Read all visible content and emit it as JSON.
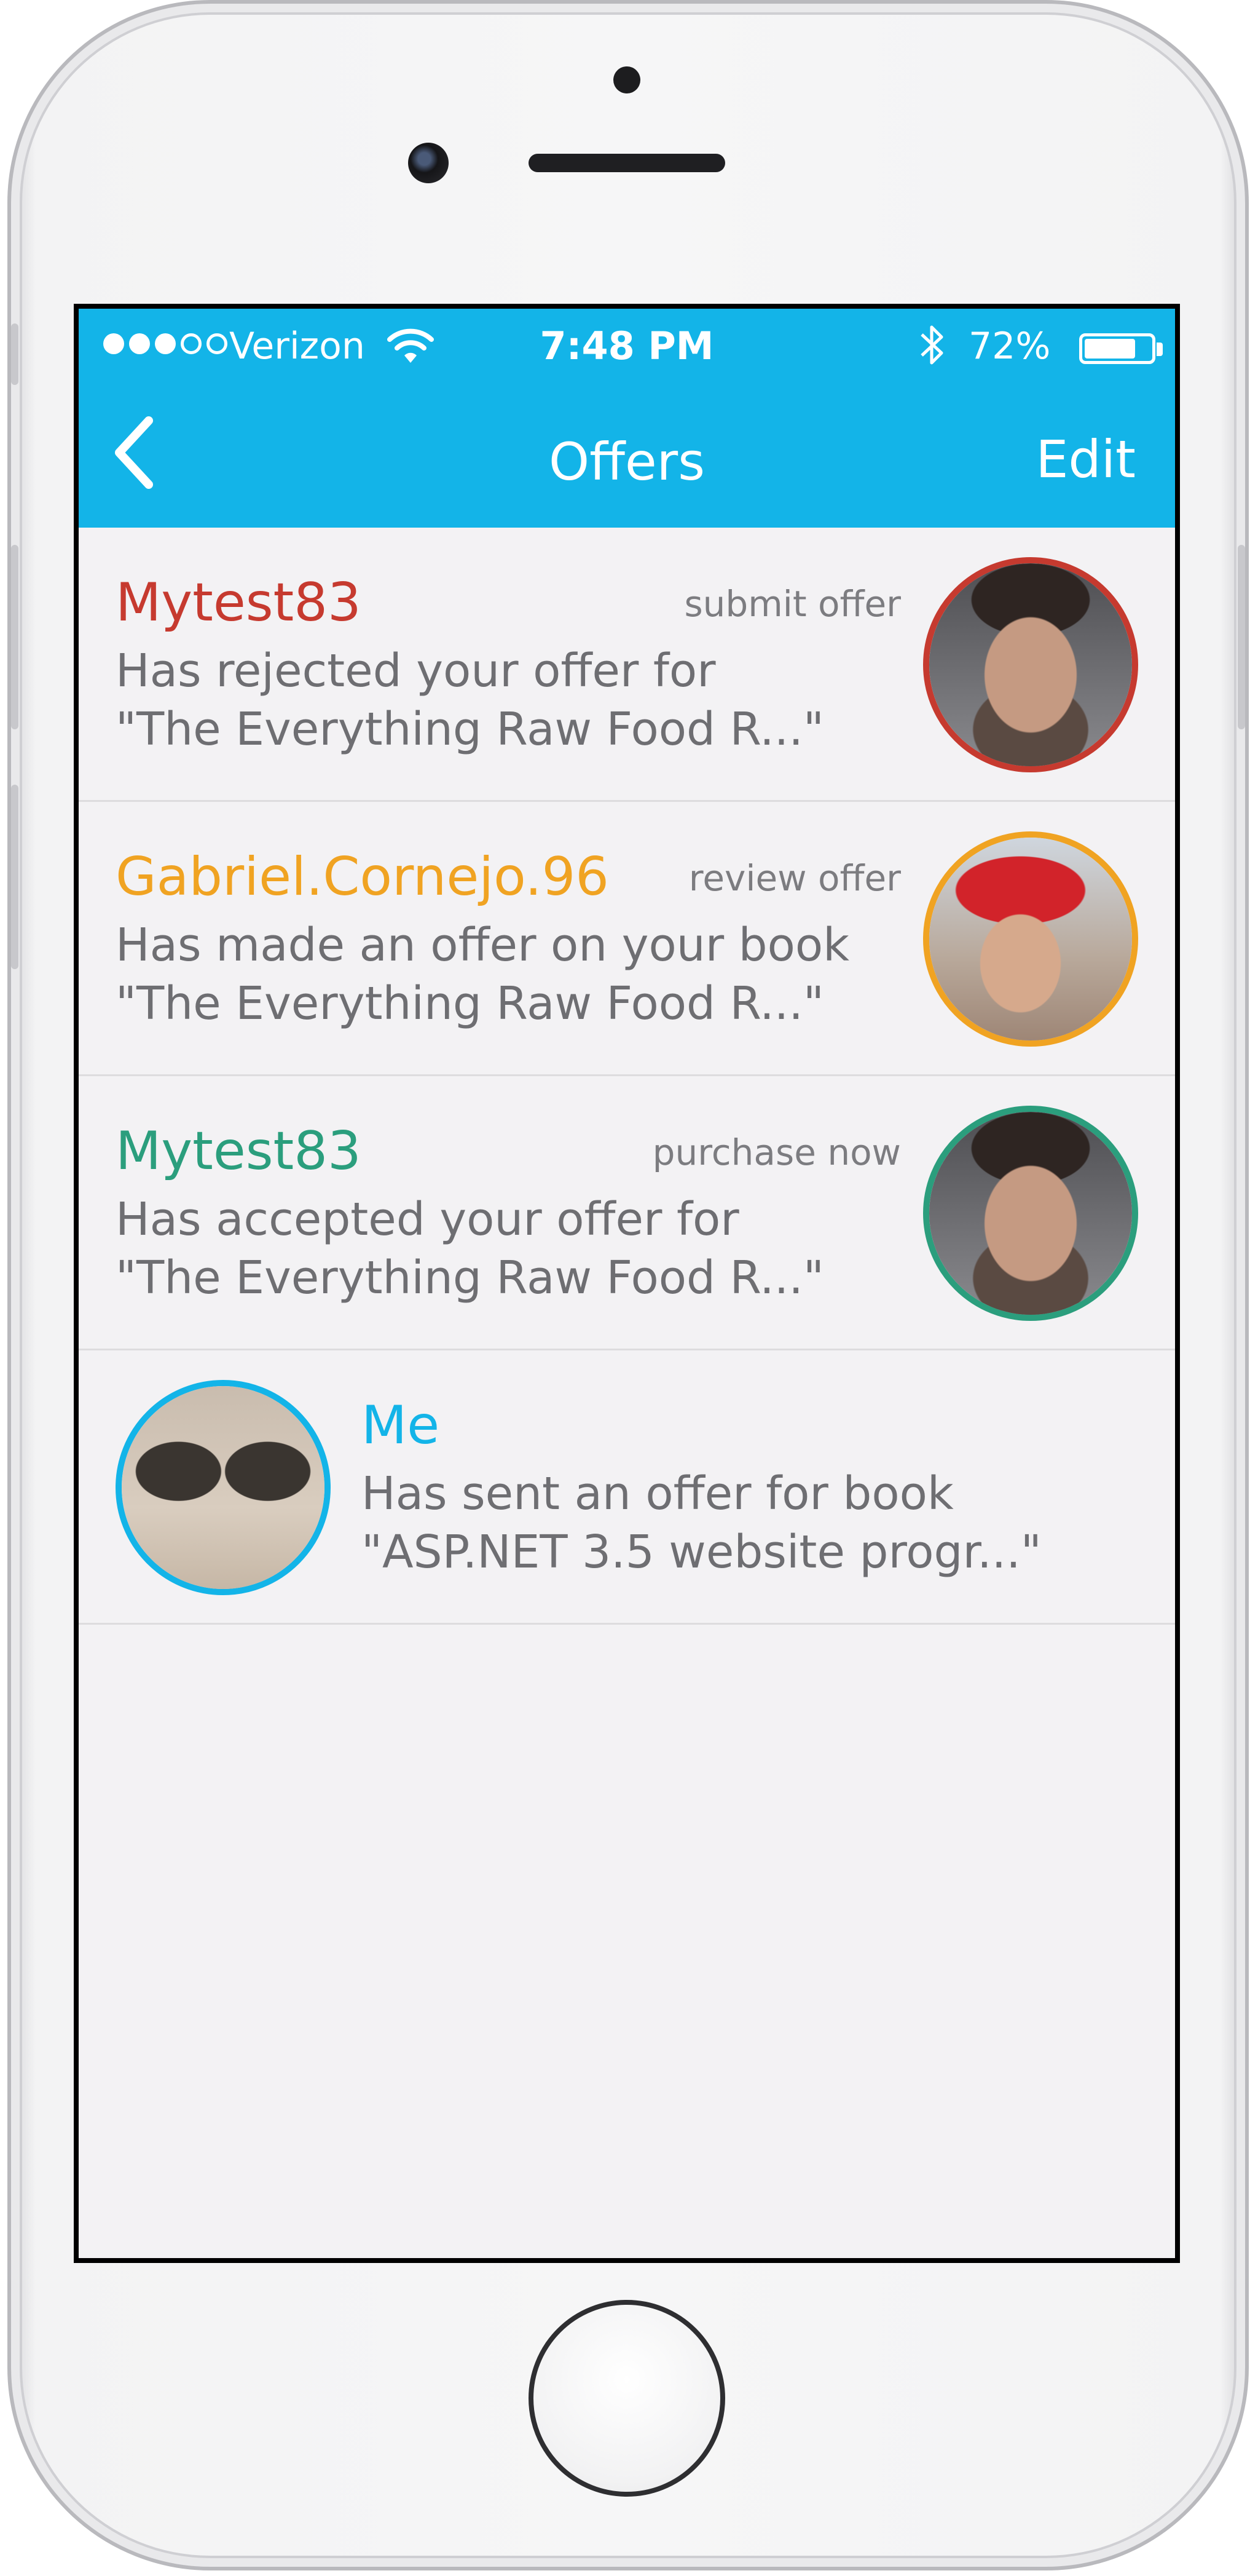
{
  "status_bar": {
    "carrier": "Verizon",
    "time": "7:48 PM",
    "battery": "72%",
    "battery_level": 0.72,
    "signal_bars": 3,
    "signal_total": 5
  },
  "nav": {
    "title": "Offers",
    "edit_label": "Edit",
    "back_icon": "chevron-left-icon"
  },
  "colors": {
    "header": "#13b4e8",
    "rejected": "#c63a2f",
    "review": "#f0a322",
    "accepted": "#2b9e7d",
    "me": "#13b4e8"
  },
  "offers": [
    {
      "name": "Mytest83",
      "action": "submit offer",
      "line1": "Has rejected your offer for",
      "line2": "\"The Everything Raw Food R...\""
    },
    {
      "name": "Gabriel.Cornejo.96",
      "action": "review offer",
      "line1": "Has made an offer on your book",
      "line2": "\"The Everything Raw Food R...\""
    },
    {
      "name": "Mytest83",
      "action": "purchase now",
      "line1": "Has accepted your offer for",
      "line2": "\"The Everything Raw Food R...\""
    },
    {
      "name": "Me",
      "line1": "Has sent an offer for book",
      "line2": "\"ASP.NET 3.5 website progr...\""
    }
  ]
}
